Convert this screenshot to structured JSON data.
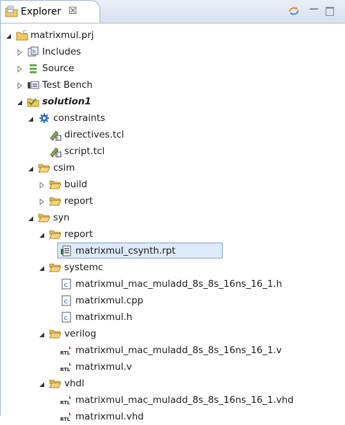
{
  "view": {
    "tab_label": "Explorer",
    "close_glyph": "☒"
  },
  "tree": {
    "project": "matrixmul.prj",
    "includes": "Includes",
    "source": "Source",
    "test_bench": "Test Bench",
    "solution": "solution1",
    "constraints": "constraints",
    "directives": "directives.tcl",
    "script": "script.tcl",
    "csim": "csim",
    "csim_build": "build",
    "csim_report": "report",
    "syn": "syn",
    "syn_report": "report",
    "rpt": "matrixmul_csynth.rpt",
    "systemc": "systemc",
    "sc_h1": "matrixmul_mac_muladd_8s_8s_16ns_16_1.h",
    "sc_cpp": "matrixmul.cpp",
    "sc_h2": "matrixmul.h",
    "verilog": "verilog",
    "v1": "matrixmul_mac_muladd_8s_8s_16ns_16_1.v",
    "v2": "matrixmul.v",
    "vhdl": "vhdl",
    "vhd1": "matrixmul_mac_muladd_8s_8s_16ns_16_1.vhd",
    "vhd2": "matrixmul.vhd"
  },
  "colors": {
    "folder": "#e8b64a",
    "selection": "#dceaf9",
    "header": "#d8e1ee"
  }
}
